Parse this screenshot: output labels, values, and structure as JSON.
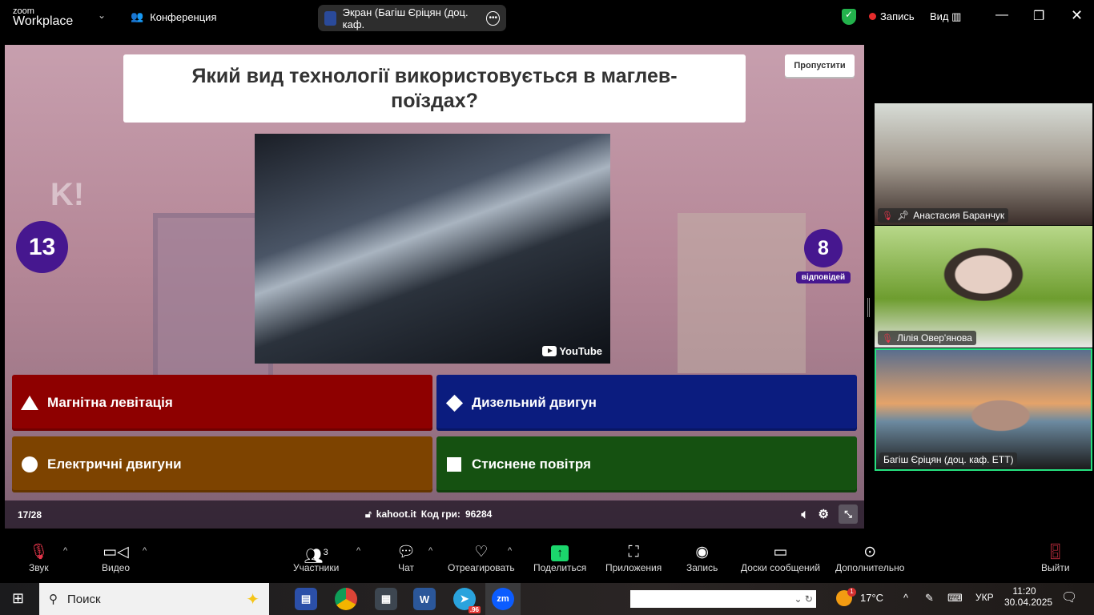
{
  "titlebar": {
    "logo_small": "zoom",
    "logo_big": "Workplace",
    "meeting_label": "Конференция",
    "screen_share": "Экран (Багіш Єріцян (доц. каф.",
    "record_label": "Запись",
    "view_label": "Вид"
  },
  "kahoot": {
    "question": "Який вид технології використовується в маглев-поїздах?",
    "skip": "Пропустити",
    "timer": "13",
    "answers_count": "8",
    "answers_label": "відповідей",
    "video_brand": "YouTube",
    "logo": "K!",
    "answers": [
      {
        "text": "Магнітна левітація",
        "shape": "triangle"
      },
      {
        "text": "Дизельний двигун",
        "shape": "diamond"
      },
      {
        "text": "Електричні двигуни",
        "shape": "circle"
      },
      {
        "text": "Стиснене повітря",
        "shape": "square"
      }
    ],
    "page": "17/28",
    "site": "kahoot.it",
    "code_label": "Код гри:",
    "code": "96284"
  },
  "participants": [
    {
      "name": "Анастасия Баранчук"
    },
    {
      "name": "Лілія Овер'янова"
    },
    {
      "name": "Багіш Єріцян (доц. каф. ЕТТ)"
    }
  ],
  "toolbar": {
    "audio": "Звук",
    "video": "Видео",
    "participants": "Участники",
    "participants_count": "3",
    "chat": "Чат",
    "react": "Отреагировать",
    "share": "Поделиться",
    "apps": "Приложения",
    "record": "Запись",
    "whiteboards": "Доски сообщений",
    "more": "Дополнительно",
    "leave": "Выйти"
  },
  "taskbar": {
    "search_placeholder": "Поиск",
    "telegram_badge": ".96",
    "weather_badge": "1",
    "temperature": "17°C",
    "lang": "УКР",
    "time": "11:20",
    "date": "30.04.2025",
    "zoom_icon": "zm"
  },
  "colors": {
    "kahoot_purple": "#46178f",
    "red": "#8e0000",
    "blue": "#0b1c7f",
    "orange": "#7d4300",
    "green": "#155111",
    "active_speaker": "#26e07f"
  }
}
